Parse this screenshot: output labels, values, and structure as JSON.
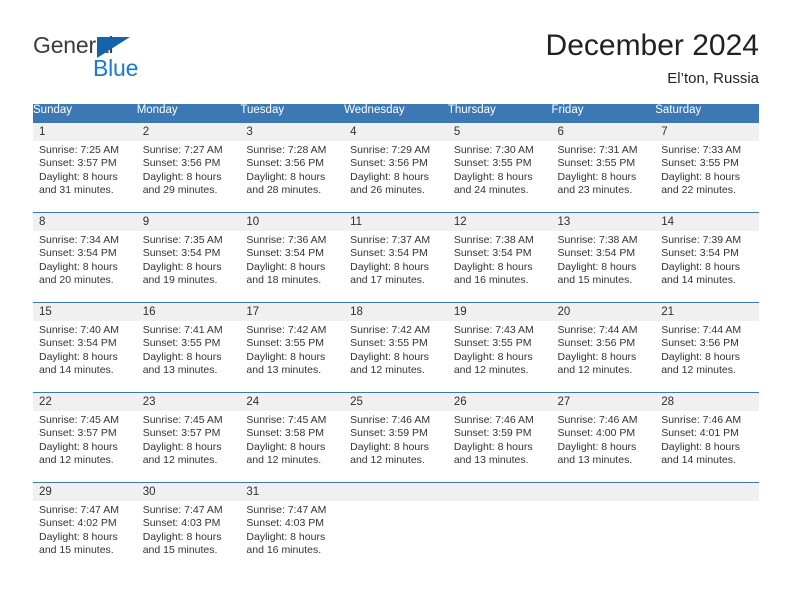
{
  "brand": {
    "name_part1": "General",
    "name_part2": "Blue",
    "accent_color": "#1463ad",
    "blue_text_color": "#1a7ad4"
  },
  "header": {
    "title": "December 2024",
    "subtitle": "El’ton, Russia"
  },
  "calendar": {
    "header_color": "#3c78b4",
    "weekday_headers": [
      "Sunday",
      "Monday",
      "Tuesday",
      "Wednesday",
      "Thursday",
      "Friday",
      "Saturday"
    ],
    "weeks": [
      [
        {
          "day": "1",
          "sunrise": "Sunrise: 7:25 AM",
          "sunset": "Sunset: 3:57 PM",
          "daylight_line1": "Daylight: 8 hours",
          "daylight_line2": "and 31 minutes."
        },
        {
          "day": "2",
          "sunrise": "Sunrise: 7:27 AM",
          "sunset": "Sunset: 3:56 PM",
          "daylight_line1": "Daylight: 8 hours",
          "daylight_line2": "and 29 minutes."
        },
        {
          "day": "3",
          "sunrise": "Sunrise: 7:28 AM",
          "sunset": "Sunset: 3:56 PM",
          "daylight_line1": "Daylight: 8 hours",
          "daylight_line2": "and 28 minutes."
        },
        {
          "day": "4",
          "sunrise": "Sunrise: 7:29 AM",
          "sunset": "Sunset: 3:56 PM",
          "daylight_line1": "Daylight: 8 hours",
          "daylight_line2": "and 26 minutes."
        },
        {
          "day": "5",
          "sunrise": "Sunrise: 7:30 AM",
          "sunset": "Sunset: 3:55 PM",
          "daylight_line1": "Daylight: 8 hours",
          "daylight_line2": "and 24 minutes."
        },
        {
          "day": "6",
          "sunrise": "Sunrise: 7:31 AM",
          "sunset": "Sunset: 3:55 PM",
          "daylight_line1": "Daylight: 8 hours",
          "daylight_line2": "and 23 minutes."
        },
        {
          "day": "7",
          "sunrise": "Sunrise: 7:33 AM",
          "sunset": "Sunset: 3:55 PM",
          "daylight_line1": "Daylight: 8 hours",
          "daylight_line2": "and 22 minutes."
        }
      ],
      [
        {
          "day": "8",
          "sunrise": "Sunrise: 7:34 AM",
          "sunset": "Sunset: 3:54 PM",
          "daylight_line1": "Daylight: 8 hours",
          "daylight_line2": "and 20 minutes."
        },
        {
          "day": "9",
          "sunrise": "Sunrise: 7:35 AM",
          "sunset": "Sunset: 3:54 PM",
          "daylight_line1": "Daylight: 8 hours",
          "daylight_line2": "and 19 minutes."
        },
        {
          "day": "10",
          "sunrise": "Sunrise: 7:36 AM",
          "sunset": "Sunset: 3:54 PM",
          "daylight_line1": "Daylight: 8 hours",
          "daylight_line2": "and 18 minutes."
        },
        {
          "day": "11",
          "sunrise": "Sunrise: 7:37 AM",
          "sunset": "Sunset: 3:54 PM",
          "daylight_line1": "Daylight: 8 hours",
          "daylight_line2": "and 17 minutes."
        },
        {
          "day": "12",
          "sunrise": "Sunrise: 7:38 AM",
          "sunset": "Sunset: 3:54 PM",
          "daylight_line1": "Daylight: 8 hours",
          "daylight_line2": "and 16 minutes."
        },
        {
          "day": "13",
          "sunrise": "Sunrise: 7:38 AM",
          "sunset": "Sunset: 3:54 PM",
          "daylight_line1": "Daylight: 8 hours",
          "daylight_line2": "and 15 minutes."
        },
        {
          "day": "14",
          "sunrise": "Sunrise: 7:39 AM",
          "sunset": "Sunset: 3:54 PM",
          "daylight_line1": "Daylight: 8 hours",
          "daylight_line2": "and 14 minutes."
        }
      ],
      [
        {
          "day": "15",
          "sunrise": "Sunrise: 7:40 AM",
          "sunset": "Sunset: 3:54 PM",
          "daylight_line1": "Daylight: 8 hours",
          "daylight_line2": "and 14 minutes."
        },
        {
          "day": "16",
          "sunrise": "Sunrise: 7:41 AM",
          "sunset": "Sunset: 3:55 PM",
          "daylight_line1": "Daylight: 8 hours",
          "daylight_line2": "and 13 minutes."
        },
        {
          "day": "17",
          "sunrise": "Sunrise: 7:42 AM",
          "sunset": "Sunset: 3:55 PM",
          "daylight_line1": "Daylight: 8 hours",
          "daylight_line2": "and 13 minutes."
        },
        {
          "day": "18",
          "sunrise": "Sunrise: 7:42 AM",
          "sunset": "Sunset: 3:55 PM",
          "daylight_line1": "Daylight: 8 hours",
          "daylight_line2": "and 12 minutes."
        },
        {
          "day": "19",
          "sunrise": "Sunrise: 7:43 AM",
          "sunset": "Sunset: 3:55 PM",
          "daylight_line1": "Daylight: 8 hours",
          "daylight_line2": "and 12 minutes."
        },
        {
          "day": "20",
          "sunrise": "Sunrise: 7:44 AM",
          "sunset": "Sunset: 3:56 PM",
          "daylight_line1": "Daylight: 8 hours",
          "daylight_line2": "and 12 minutes."
        },
        {
          "day": "21",
          "sunrise": "Sunrise: 7:44 AM",
          "sunset": "Sunset: 3:56 PM",
          "daylight_line1": "Daylight: 8 hours",
          "daylight_line2": "and 12 minutes."
        }
      ],
      [
        {
          "day": "22",
          "sunrise": "Sunrise: 7:45 AM",
          "sunset": "Sunset: 3:57 PM",
          "daylight_line1": "Daylight: 8 hours",
          "daylight_line2": "and 12 minutes."
        },
        {
          "day": "23",
          "sunrise": "Sunrise: 7:45 AM",
          "sunset": "Sunset: 3:57 PM",
          "daylight_line1": "Daylight: 8 hours",
          "daylight_line2": "and 12 minutes."
        },
        {
          "day": "24",
          "sunrise": "Sunrise: 7:45 AM",
          "sunset": "Sunset: 3:58 PM",
          "daylight_line1": "Daylight: 8 hours",
          "daylight_line2": "and 12 minutes."
        },
        {
          "day": "25",
          "sunrise": "Sunrise: 7:46 AM",
          "sunset": "Sunset: 3:59 PM",
          "daylight_line1": "Daylight: 8 hours",
          "daylight_line2": "and 12 minutes."
        },
        {
          "day": "26",
          "sunrise": "Sunrise: 7:46 AM",
          "sunset": "Sunset: 3:59 PM",
          "daylight_line1": "Daylight: 8 hours",
          "daylight_line2": "and 13 minutes."
        },
        {
          "day": "27",
          "sunrise": "Sunrise: 7:46 AM",
          "sunset": "Sunset: 4:00 PM",
          "daylight_line1": "Daylight: 8 hours",
          "daylight_line2": "and 13 minutes."
        },
        {
          "day": "28",
          "sunrise": "Sunrise: 7:46 AM",
          "sunset": "Sunset: 4:01 PM",
          "daylight_line1": "Daylight: 8 hours",
          "daylight_line2": "and 14 minutes."
        }
      ],
      [
        {
          "day": "29",
          "sunrise": "Sunrise: 7:47 AM",
          "sunset": "Sunset: 4:02 PM",
          "daylight_line1": "Daylight: 8 hours",
          "daylight_line2": "and 15 minutes."
        },
        {
          "day": "30",
          "sunrise": "Sunrise: 7:47 AM",
          "sunset": "Sunset: 4:03 PM",
          "daylight_line1": "Daylight: 8 hours",
          "daylight_line2": "and 15 minutes."
        },
        {
          "day": "31",
          "sunrise": "Sunrise: 7:47 AM",
          "sunset": "Sunset: 4:03 PM",
          "daylight_line1": "Daylight: 8 hours",
          "daylight_line2": "and 16 minutes."
        },
        {
          "day": "",
          "sunrise": "",
          "sunset": "",
          "daylight_line1": "",
          "daylight_line2": ""
        },
        {
          "day": "",
          "sunrise": "",
          "sunset": "",
          "daylight_line1": "",
          "daylight_line2": ""
        },
        {
          "day": "",
          "sunrise": "",
          "sunset": "",
          "daylight_line1": "",
          "daylight_line2": ""
        },
        {
          "day": "",
          "sunrise": "",
          "sunset": "",
          "daylight_line1": "",
          "daylight_line2": ""
        }
      ]
    ]
  }
}
